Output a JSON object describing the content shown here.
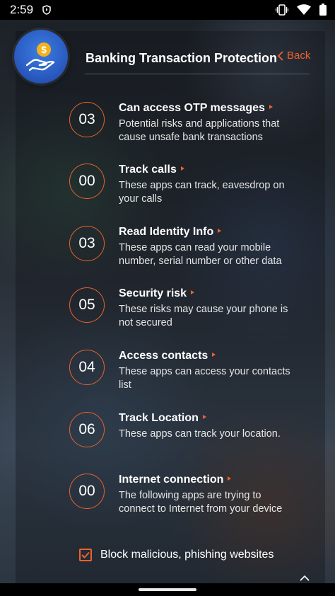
{
  "status_bar": {
    "time": "2:59",
    "icons": [
      "shield-icon",
      "vibrate-icon",
      "wifi-icon",
      "battery-icon"
    ]
  },
  "header": {
    "title": "Banking Transaction Protection",
    "back_label": "Back",
    "logo_icon": "hand-holding-coin-icon"
  },
  "items": [
    {
      "count": "03",
      "title": "Can access OTP messages",
      "description": "Potential risks and applications that cause unsafe bank transactions"
    },
    {
      "count": "00",
      "title": "Track calls",
      "description": "These apps can track, eavesdrop on your calls"
    },
    {
      "count": "03",
      "title": "Read Identity Info",
      "description": "These apps can read your mobile number, serial number or other data"
    },
    {
      "count": "05",
      "title": "Security risk",
      "description": "These risks may cause your phone is not secured"
    },
    {
      "count": "04",
      "title": "Access contacts",
      "description": "These apps can access your contacts list"
    },
    {
      "count": "06",
      "title": "Track Location",
      "description": "These apps can track your location."
    },
    {
      "count": "00",
      "title": "Internet connection",
      "description": "The following apps are trying to connect to Internet from your device"
    }
  ],
  "block_option": {
    "label": "Block malicious, phishing websites",
    "checked": true
  },
  "colors": {
    "accent": "#f0622a",
    "logo_blue": "#2a5cc2"
  }
}
